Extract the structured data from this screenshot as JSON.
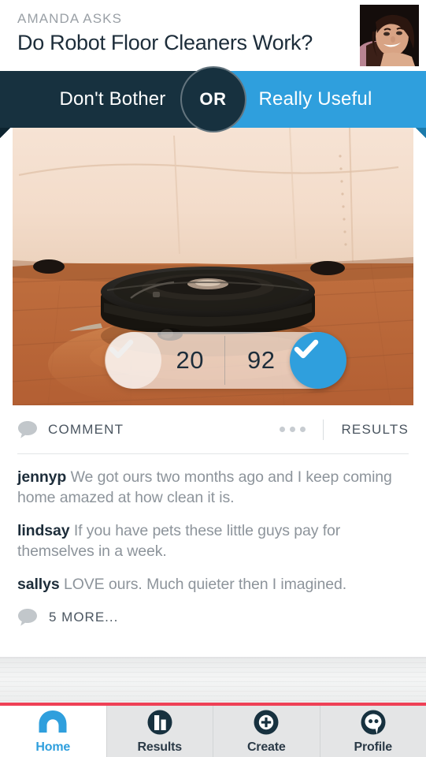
{
  "header": {
    "asker": "AMANDA ASKS",
    "title": "Do Robot Floor Cleaners Work?",
    "avatar_icon": "user-photo-avatar"
  },
  "vote_bar": {
    "left_option": "Don't Bother",
    "divider_label": "OR",
    "right_option": "Really Useful",
    "left_color": "#17313f",
    "right_color": "#2f9fdd"
  },
  "photo": {
    "alt_icon": "robot-vacuum-on-hardwood-floor-photo"
  },
  "vote_pill": {
    "left_count": "20",
    "right_count": "92",
    "left_check_icon": "check-icon-unselected",
    "right_check_icon": "check-icon-selected",
    "selected_side": "right",
    "selected_color": "#2f9fdd"
  },
  "action_bar": {
    "comment_icon": "speech-bubble-icon",
    "comment_label": "COMMENT",
    "overflow_icon": "ellipsis-icon",
    "results_label": "RESULTS"
  },
  "comments": [
    {
      "user": "jennyp",
      "text": "We got ours two months ago and I keep coming home amazed at how clean it is."
    },
    {
      "user": "lindsay",
      "text": "If you have pets these little guys pay for themselves in a week."
    },
    {
      "user": "sallys",
      "text": "LOVE ours. Much quieter then I imagined."
    }
  ],
  "more_comments": {
    "icon": "speech-bubble-icon",
    "label": "5 MORE..."
  },
  "accent_line_color": "#ef4056",
  "nav": {
    "items": [
      {
        "label": "Home",
        "icon": "home-arch-icon",
        "active": true
      },
      {
        "label": "Results",
        "icon": "bar-chart-circle-icon",
        "active": false
      },
      {
        "label": "Create",
        "icon": "plus-circle-icon",
        "active": false
      },
      {
        "label": "Profile",
        "icon": "speech-face-icon",
        "active": false
      }
    ]
  }
}
